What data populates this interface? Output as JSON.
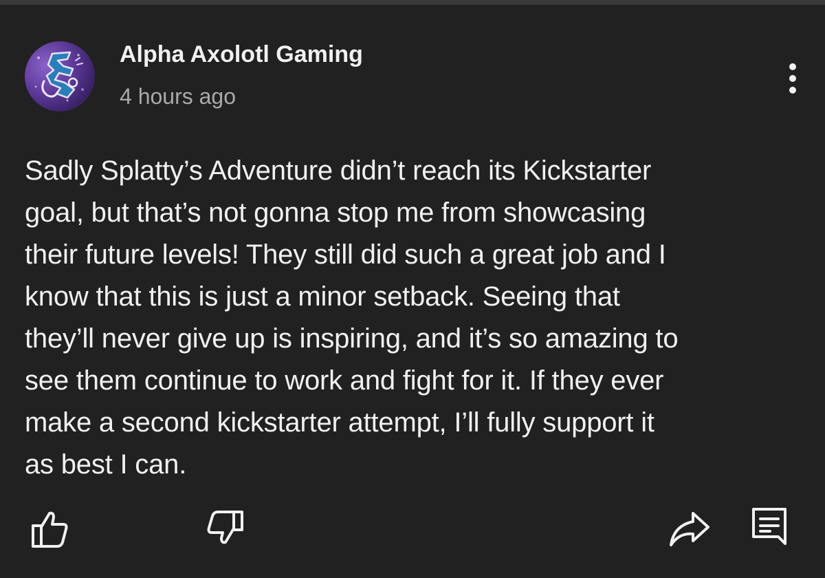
{
  "comment": {
    "author": "Alpha Axolotl Gaming",
    "timestamp": "4 hours ago",
    "avatar_icon": "axolotl-logo-icon",
    "body": "Sadly Splatty’s Adventure didn’t reach its Kickstarter\ngoal, but that’s not gonna stop me from showcasing\ntheir future levels! They still did such a great job and I\nknow that this is just a minor setback. Seeing that\nthey’ll never give up is inspiring, and it’s so amazing to\nsee them continue to work and fight for it. If they ever\nmake a second kickstarter attempt, I’ll fully support it\nas best I can."
  },
  "actions": {
    "more_icon": "more-vertical-icon",
    "like_icon": "thumbs-up-icon",
    "dislike_icon": "thumbs-down-icon",
    "share_icon": "share-arrow-icon",
    "reply_icon": "reply-comment-icon"
  },
  "colors": {
    "background": "#212121",
    "primary_text": "#f1f1f1",
    "secondary_text": "#aaaaaa",
    "avatar_purple": "#5a3794"
  }
}
